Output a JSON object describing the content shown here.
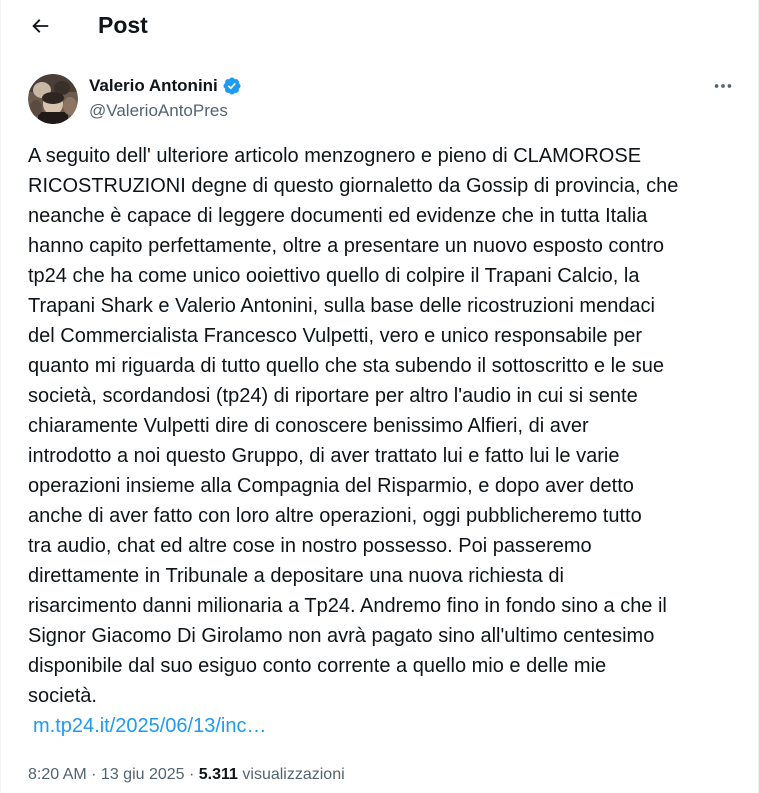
{
  "header": {
    "title": "Post"
  },
  "author": {
    "name": "Valerio Antonini",
    "handle": "@ValerioAntoPres",
    "verified_color": "#1d9bf0"
  },
  "tweet": {
    "lines": [
      "A seguito dell' ulteriore articolo menzognero e pieno di CLAMOROSE",
      "RICOSTRUZIONI degne di questo  giornaletto da Gossip di provincia, che",
      "neanche è capace di leggere documenti ed evidenze che in tutta Italia",
      "hanno capito perfettamente, oltre a presentare un nuovo esposto contro",
      "tp24 che ha come unico ooiettivo quello di colpire il Trapani Calcio, la",
      "Trapani Shark e Valerio Antonini, sulla base delle ricostruzioni mendaci",
      "del Commercialista Francesco Vulpetti, vero e unico responsabile per",
      "quanto mi riguarda di tutto quello che sta subendo il sottoscritto e le sue",
      "società, scordandosi (tp24) di riportare per altro l'audio in cui si sente",
      "chiaramente Vulpetti dire di conoscere benissimo Alfieri, di aver",
      "introdotto a noi questo Gruppo, di aver trattato lui e fatto lui le varie",
      "operazioni insieme alla Compagnia del Risparmio, e dopo aver detto",
      "anche di aver fatto con loro altre operazioni, oggi pubblicheremo tutto",
      "tra audio, chat ed altre cose in nostro possesso. Poi passeremo",
      "direttamente in Tribunale a depositare una nuova richiesta di",
      "risarcimento danni milionaria a Tp24. Andremo fino in fondo sino a che il",
      "Signor Giacomo Di Girolamo non avrà pagato sino all'ultimo centesimo",
      "disponibile dal suo esiguo conto corrente a quello mio e delle mie",
      "società."
    ],
    "link": "m.tp24.it/2025/06/13/inc…"
  },
  "meta": {
    "time": "8:20 AM",
    "separator": " · ",
    "date": "13 giu 2025",
    "views_count": "5.311",
    "views_label": " visualizzazioni"
  },
  "colors": {
    "text": "#0f1419",
    "secondary": "#536471",
    "link": "#1d9bf0"
  }
}
